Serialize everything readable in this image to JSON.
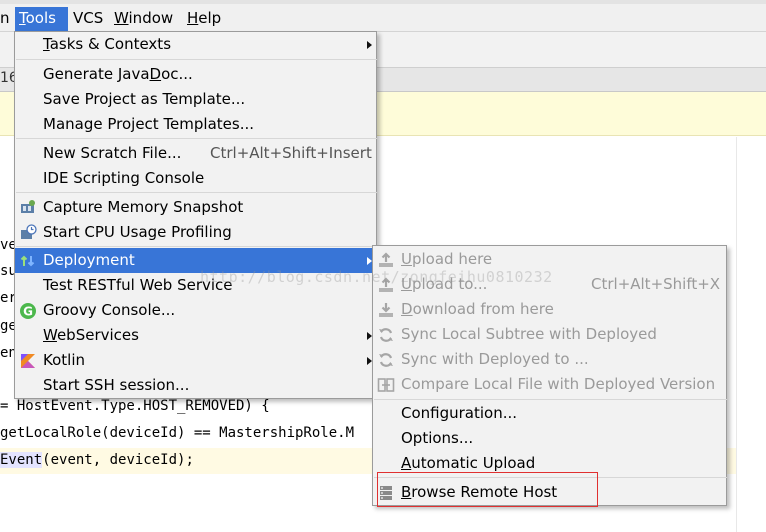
{
  "menubar": {
    "items": [
      {
        "pre": "",
        "ul": "",
        "post": "n"
      },
      {
        "pre": "",
        "ul": "T",
        "post": "ools"
      },
      {
        "pre": "VCS",
        "ul": "",
        "post": ""
      },
      {
        "pre": "",
        "ul": "W",
        "post": "indow"
      },
      {
        "pre": "",
        "ul": "H",
        "post": "elp"
      }
    ]
  },
  "tab_fragment": "16",
  "code_lines": [
    {
      "text": "ve"
    },
    {
      "text": "su"
    },
    {
      "text": "er"
    },
    {
      "text": "ge"
    },
    {
      "text": "en"
    },
    {
      "text": "= HostEvent.Type.HOST_REMOVED) {"
    },
    {
      "text": "getLocalRole(deviceId) == MastershipRole.M"
    },
    {
      "pre": "",
      "sel": "Event",
      "post": "(event, deviceId);"
    }
  ],
  "tools_menu": {
    "items": [
      {
        "pre": "",
        "ul": "T",
        "post": "asks & Contexts",
        "submenu": true
      },
      {
        "pre": "Generate Java",
        "ul": "D",
        "post": "oc..."
      },
      {
        "pre": "Save Project as Template...",
        "ul": "",
        "post": ""
      },
      {
        "pre": "Manage Project Templates...",
        "ul": "",
        "post": ""
      },
      {
        "pre": "New Scratch File...",
        "ul": "",
        "post": "",
        "shortcut": "Ctrl+Alt+Shift+Insert"
      },
      {
        "pre": "IDE Scripting Console",
        "ul": "",
        "post": ""
      },
      {
        "pre": "Capture Memory Snapshot",
        "ul": "",
        "post": "",
        "icon": "memory-snapshot-icon"
      },
      {
        "pre": "Start CPU Usage Profiling",
        "ul": "",
        "post": "",
        "icon": "cpu-profiling-icon"
      },
      {
        "pre": "Deployment",
        "ul": "",
        "post": "",
        "icon": "deployment-icon",
        "submenu": true,
        "active": true
      },
      {
        "pre": "Test RESTful Web Service",
        "ul": "",
        "post": ""
      },
      {
        "pre": "Groovy Console...",
        "ul": "",
        "post": "",
        "icon": "groovy-icon"
      },
      {
        "pre": "",
        "ul": "W",
        "post": "ebServices",
        "submenu": true
      },
      {
        "pre": "Kotlin",
        "ul": "",
        "post": "",
        "icon": "kotlin-icon",
        "submenu": true
      },
      {
        "pre": "Start SSH session...",
        "ul": "",
        "post": ""
      }
    ]
  },
  "deployment_menu": {
    "items": [
      {
        "pre": "",
        "ul": "U",
        "post": "pload here",
        "icon": "upload-icon",
        "disabled": true
      },
      {
        "pre": "",
        "ul": "U",
        "post": "pload to...",
        "icon": "upload-icon",
        "disabled": true,
        "shortcut": "Ctrl+Alt+Shift+X"
      },
      {
        "pre": "",
        "ul": "D",
        "post": "ownload from here",
        "icon": "download-icon",
        "disabled": true
      },
      {
        "pre": "Sync Local Subtree with Deployed",
        "ul": "",
        "post": "",
        "icon": "sync-icon",
        "disabled": true
      },
      {
        "pre": "Sync with Deployed to ...",
        "ul": "",
        "post": "",
        "icon": "sync-icon",
        "disabled": true
      },
      {
        "pre": "Compare Local File with Deployed Version",
        "ul": "",
        "post": "",
        "icon": "compare-icon",
        "disabled": true
      },
      {
        "pre": "Configuration...",
        "ul": "",
        "post": ""
      },
      {
        "pre": "Options...",
        "ul": "",
        "post": ""
      },
      {
        "pre": "",
        "ul": "A",
        "post": "utomatic Upload"
      },
      {
        "pre": "",
        "ul": "B",
        "post": "rowse Remote Host",
        "icon": "remote-host-icon",
        "highlighted": true
      }
    ]
  },
  "watermark": "http://blog.csdn.net/zongfeihu0810232",
  "colors": {
    "menu_bg": "#f2f2f2",
    "selection": "#3875d7",
    "disabled_text": "#9a9a9a",
    "highlight_box": "#e03030"
  }
}
